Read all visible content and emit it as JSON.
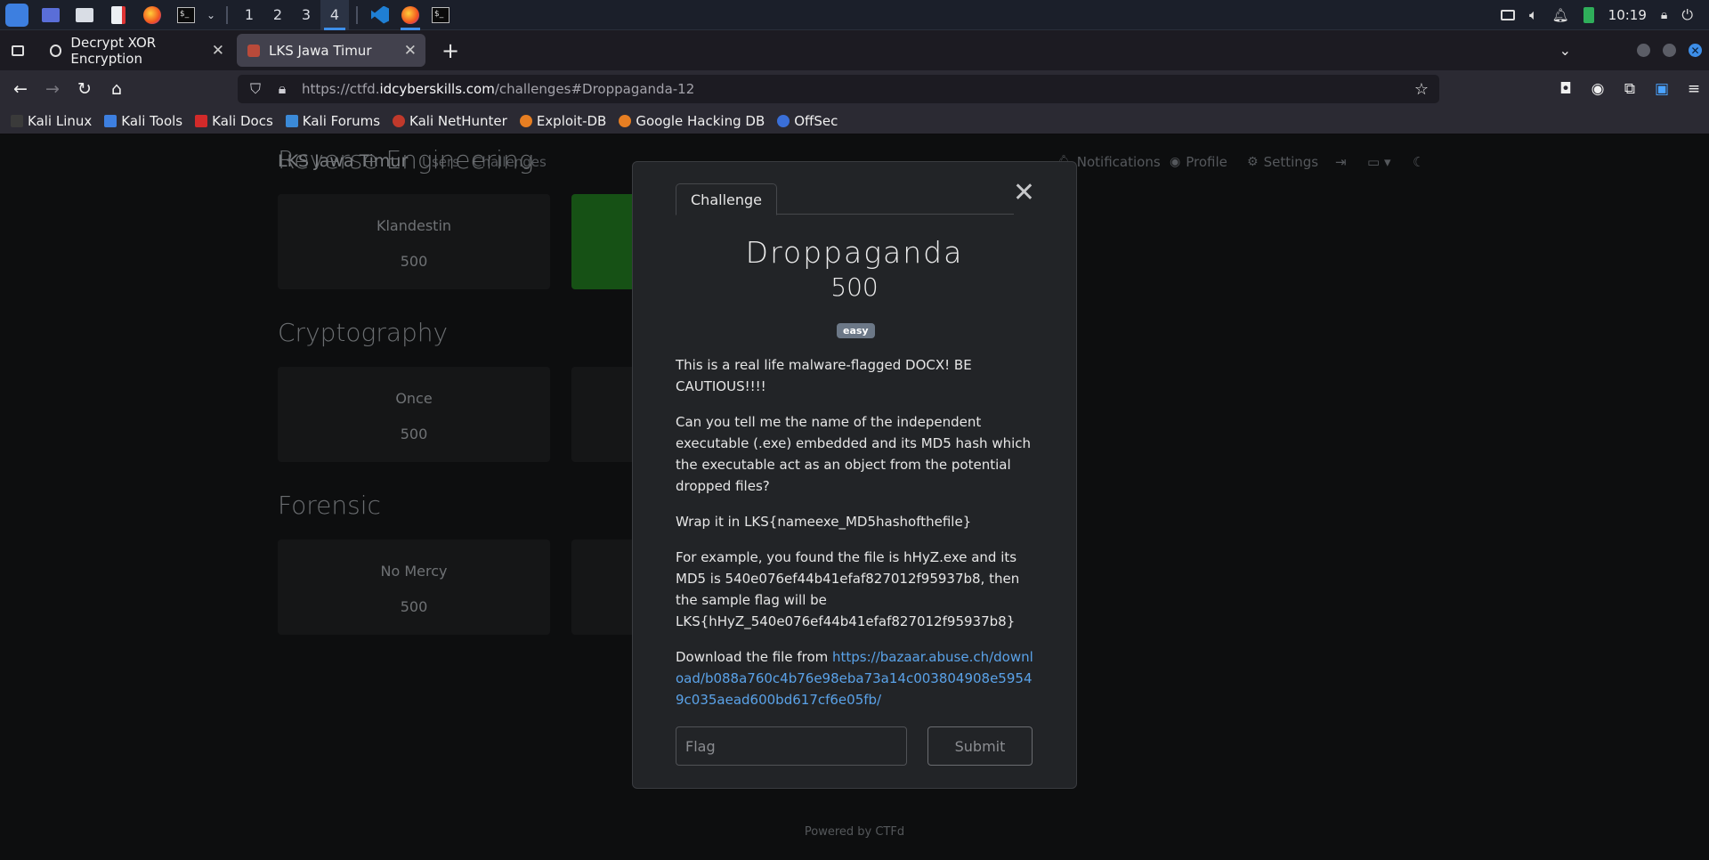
{
  "taskbar": {
    "workspaces": [
      "1",
      "2",
      "3",
      "4"
    ],
    "active_workspace": "4",
    "clock": "10:19",
    "colors": {
      "accent": "#3d8ee8",
      "background": "#1b1f2a"
    }
  },
  "browser": {
    "tabs": [
      {
        "title": "Decrypt XOR Encryption",
        "favicon": "globe-icon"
      },
      {
        "title": "LKS Jawa Timur",
        "favicon": "ctfd-icon"
      }
    ],
    "url_prefix": "https://ctfd.",
    "url_domain": "idcyberskills.com",
    "url_path": "/challenges#Droppaganda-12",
    "bookmarks": [
      "Kali Linux",
      "Kali Tools",
      "Kali Docs",
      "Kali Forums",
      "Kali NetHunter",
      "Exploit-DB",
      "Google Hacking DB",
      "OffSec"
    ]
  },
  "site": {
    "brand": "LKS Jawa Timur",
    "nav": {
      "users": "Users",
      "challenges": "Challenges"
    },
    "nav_right": {
      "notifications": "Notifications",
      "profile": "Profile",
      "settings": "Settings"
    },
    "footer": "Powered by CTFd"
  },
  "categories": [
    {
      "title": "Reverse Engineering",
      "cards": [
        {
          "name": "Klandestin",
          "value": "500"
        }
      ]
    },
    {
      "title": "Cryptography",
      "cards": [
        {
          "name": "Once",
          "value": "500"
        }
      ]
    },
    {
      "title": "Forensic",
      "cards": [
        {
          "name": "No Mercy",
          "value": "500"
        }
      ]
    }
  ],
  "modal": {
    "tab": "Challenge",
    "name": "Droppaganda",
    "value": "500",
    "badge": "easy",
    "paragraphs": [
      "This is a real life malware-flagged DOCX! BE CAUTIOUS!!!!",
      "Can you tell me the name of the independent executable (.exe) embedded and its MD5 hash which the executable act as an object from the potential dropped files?",
      "Wrap it in LKS{nameexe_MD5hashofthefile}",
      "For example, you found the file is hHyZ.exe and its MD5 is 540e076ef44b41efaf827012f95937b8, then the sample flag will be LKS{hHyZ_540e076ef44b41efaf827012f95937b8}"
    ],
    "download_text": "Download the file from ",
    "download_link": "https://bazaar.abuse.ch/download/b088a760c4b76e98eba73a14c003804908e59549c035aead600bd617cf6e05fb/",
    "flag_placeholder": "Flag",
    "submit_label": "Submit"
  }
}
